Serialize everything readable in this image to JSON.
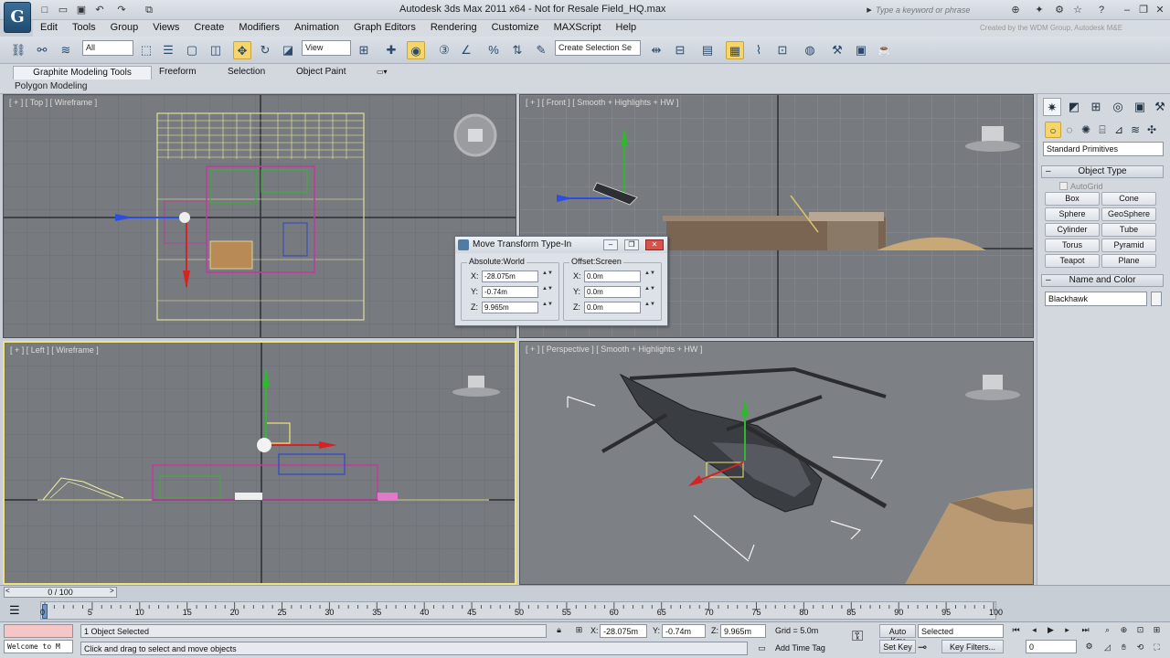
{
  "app": {
    "logo_text": "G",
    "title": "Autodesk 3ds Max 2011 x64  -  Not for Resale   Field_HQ.max",
    "search_placeholder": "Type a keyword or phrase",
    "watermark": "Created by the WDM Group, Autodesk M&E"
  },
  "menu": [
    "Edit",
    "Tools",
    "Group",
    "Views",
    "Create",
    "Modifiers",
    "Animation",
    "Graph Editors",
    "Rendering",
    "Customize",
    "MAXScript",
    "Help"
  ],
  "toolbar": {
    "selection_filter": "All",
    "ref_coord": "View",
    "named_selection": "Create Selection Se"
  },
  "ribbon": {
    "tabs": [
      "Graphite Modeling Tools",
      "Freeform",
      "Selection",
      "Object Paint"
    ],
    "panel": "Polygon Modeling"
  },
  "viewports": {
    "top": "[ + ] [ Top ] [ Wireframe ]",
    "front": "[ + ] [ Front ] [ Smooth + Highlights + HW ]",
    "left": "[ + ] [ Left ] [ Wireframe ]",
    "perspective": "[ + ] [ Perspective ] [ Smooth + Highlights + HW ]"
  },
  "dialog": {
    "title": "Move Transform Type-In",
    "absolute_group": "Absolute:World",
    "offset_group": "Offset:Screen",
    "abs": {
      "x": "-28.075m",
      "y": "-0.74m",
      "z": "9.965m"
    },
    "off": {
      "x": "0.0m",
      "y": "0.0m",
      "z": "0.0m"
    },
    "labels": {
      "x": "X:",
      "y": "Y:",
      "z": "Z:"
    }
  },
  "command_panel": {
    "category": "Standard Primitives",
    "object_type_title": "Object Type",
    "autogrid": "AutoGrid",
    "buttons": [
      "Box",
      "Cone",
      "Sphere",
      "GeoSphere",
      "Cylinder",
      "Tube",
      "Torus",
      "Pyramid",
      "Teapot",
      "Plane"
    ],
    "name_color_title": "Name and Color",
    "object_name": "Blackhawk"
  },
  "timeline": {
    "slider": "0 / 100",
    "ticks": [
      "0",
      "5",
      "10",
      "15",
      "20",
      "25",
      "30",
      "35",
      "40",
      "45",
      "50",
      "55",
      "60",
      "65",
      "70",
      "75",
      "80",
      "85",
      "90",
      "95",
      "100"
    ]
  },
  "status": {
    "listener": "Welcome to M",
    "selected": "1 Object Selected",
    "prompt": "Click and drag to select and move objects",
    "x": "-28.075m",
    "y": "-0.74m",
    "z": "9.965m",
    "grid": "Grid = 5.0m",
    "auto_key": "Auto Key",
    "set_key": "Set Key",
    "key_mode": "Selected",
    "key_filters": "Key Filters...",
    "add_time_tag": "Add Time Tag",
    "frame": "0",
    "labels": {
      "x": "X:",
      "y": "Y:",
      "z": "Z:"
    }
  }
}
